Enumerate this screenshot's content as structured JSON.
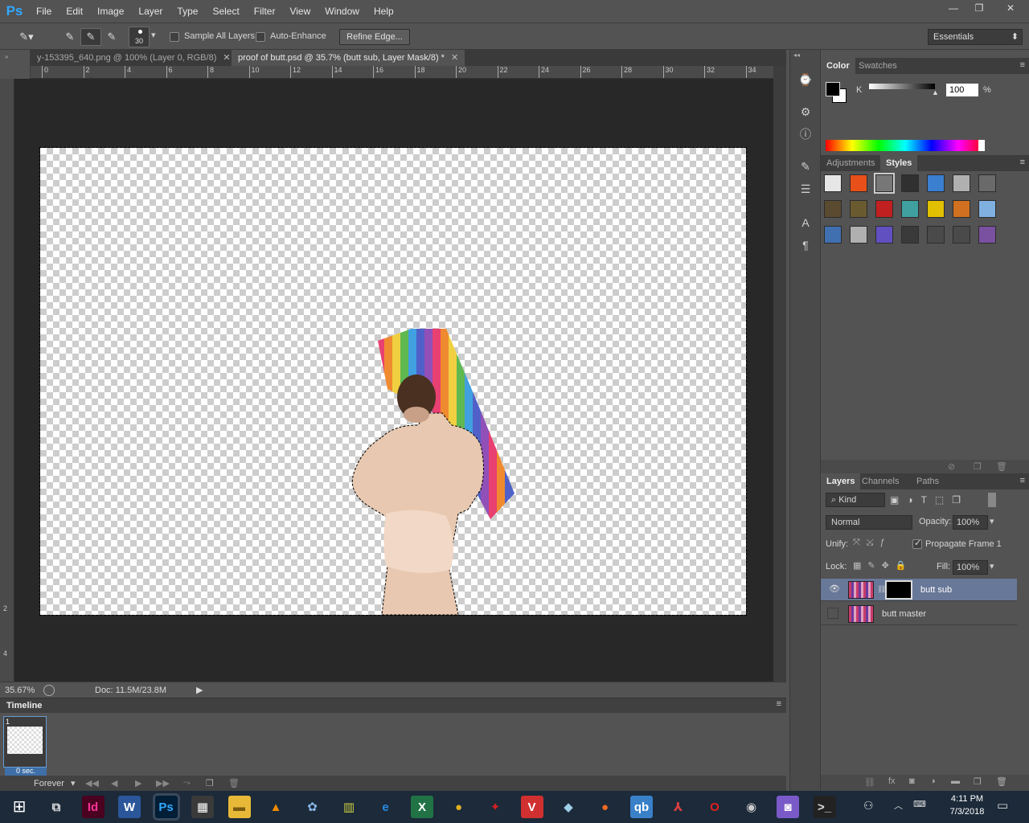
{
  "app": {
    "logo": "Ps",
    "menu": [
      "File",
      "Edit",
      "Image",
      "Layer",
      "Type",
      "Select",
      "Filter",
      "View",
      "Window",
      "Help"
    ]
  },
  "window_controls": {
    "minimize": "—",
    "restore": "❐",
    "close": "✕"
  },
  "options": {
    "brush_size": "30",
    "sample_all_layers": "Sample All Layers",
    "auto_enhance": "Auto-Enhance",
    "refine_edge": "Refine Edge...",
    "workspace": "Essentials"
  },
  "tabs": [
    {
      "label": "y-153395_640.png @ 100% (Layer 0, RGB/8)",
      "close": "✕"
    },
    {
      "label": "proof of butt.psd @ 35.7% (butt sub, Layer Mask/8) *",
      "close": "✕"
    }
  ],
  "ruler": {
    "h": [
      "0",
      "2",
      "4",
      "6",
      "8",
      "10",
      "12",
      "14",
      "16",
      "18",
      "20",
      "22",
      "24",
      "26",
      "28",
      "30",
      "32",
      "34"
    ],
    "v": [
      "2",
      "4"
    ]
  },
  "status": {
    "zoom": "35.67%",
    "doc": "Doc: 11.5M/23.8M"
  },
  "timeline": {
    "title": "Timeline",
    "frame_number": "1",
    "frame_delay": "0 sec.",
    "loop": "Forever"
  },
  "color_panel": {
    "tabs": [
      "Color",
      "Swatches"
    ],
    "channel": "K",
    "value": "100",
    "unit": "%",
    "slider_fraction": 1.0
  },
  "adjust_panel": {
    "tabs": [
      "Adjustments",
      "Styles"
    ]
  },
  "styles": [
    "#e6e6e6",
    "#e8501a",
    "#777777",
    "#303030",
    "#3a7fd0",
    "#b0b0b0",
    "#6a6a6a",
    "#5a4a30",
    "#6a5a30",
    "#c02020",
    "#40a0a0",
    "#e0c000",
    "#d07020",
    "#80b0e0",
    "#4070b0",
    "#b0b0b0",
    "#6050c0",
    "#3a3a3a",
    "#4a4a4a",
    "#4a4a4a",
    "#7a50a0"
  ],
  "layers_panel": {
    "tabs": [
      "Layers",
      "Channels",
      "Paths"
    ],
    "kind": "Kind",
    "blend": "Normal",
    "opacity_label": "Opacity:",
    "opacity": "100%",
    "unify": "Unify:",
    "propagate": "Propagate Frame 1",
    "lock": "Lock:",
    "fill_label": "Fill:",
    "fill": "100%",
    "layers": [
      {
        "name": "butt sub",
        "visible": true,
        "selected": true
      },
      {
        "name": "butt master",
        "visible": false,
        "selected": false
      }
    ]
  },
  "taskbar": {
    "time": "4:11 PM",
    "date": "7/3/2018",
    "apps": [
      {
        "name": "task-view",
        "glyph": "⧉",
        "bg": "transparent",
        "fg": "#ddd"
      },
      {
        "name": "indesign",
        "glyph": "Id",
        "bg": "#49021f",
        "fg": "#ff3399"
      },
      {
        "name": "word",
        "glyph": "W",
        "bg": "#2b579a",
        "fg": "#fff"
      },
      {
        "name": "photoshop",
        "glyph": "Ps",
        "bg": "#001e36",
        "fg": "#31a8ff"
      },
      {
        "name": "calculator",
        "glyph": "▦",
        "bg": "#3a3a3a",
        "fg": "#fff"
      },
      {
        "name": "file-explorer",
        "glyph": "▬",
        "bg": "#e8b838",
        "fg": "#7a5a10"
      },
      {
        "name": "vlc",
        "glyph": "▲",
        "bg": "transparent",
        "fg": "#f08a00"
      },
      {
        "name": "paint",
        "glyph": "✿",
        "bg": "transparent",
        "fg": "#8ab8e8"
      },
      {
        "name": "audio-app",
        "glyph": "▥",
        "bg": "transparent",
        "fg": "#d0d040"
      },
      {
        "name": "edge",
        "glyph": "e",
        "bg": "transparent",
        "fg": "#2a8ae0"
      },
      {
        "name": "excel",
        "glyph": "X",
        "bg": "#217346",
        "fg": "#fff"
      },
      {
        "name": "chrome",
        "glyph": "●",
        "bg": "transparent",
        "fg": "#e0b020"
      },
      {
        "name": "game-app",
        "glyph": "✦",
        "bg": "transparent",
        "fg": "#d02020"
      },
      {
        "name": "vivaldi",
        "glyph": "V",
        "bg": "#d03030",
        "fg": "#fff"
      },
      {
        "name": "notes-app",
        "glyph": "◆",
        "bg": "transparent",
        "fg": "#a0d0e8"
      },
      {
        "name": "firefox",
        "glyph": "●",
        "bg": "transparent",
        "fg": "#f06a20"
      },
      {
        "name": "qbittorrent",
        "glyph": "qb",
        "bg": "#3a80c8",
        "fg": "#fff"
      },
      {
        "name": "acrobat",
        "glyph": "⅄",
        "bg": "transparent",
        "fg": "#e04040"
      },
      {
        "name": "opera",
        "glyph": "O",
        "bg": "transparent",
        "fg": "#e02020"
      },
      {
        "name": "obs",
        "glyph": "◉",
        "bg": "transparent",
        "fg": "#ccc"
      },
      {
        "name": "discord-app",
        "glyph": "◙",
        "bg": "#7a5ac8",
        "fg": "#fff"
      },
      {
        "name": "terminal",
        "glyph": ">_",
        "bg": "#222",
        "fg": "#ddd"
      }
    ]
  }
}
